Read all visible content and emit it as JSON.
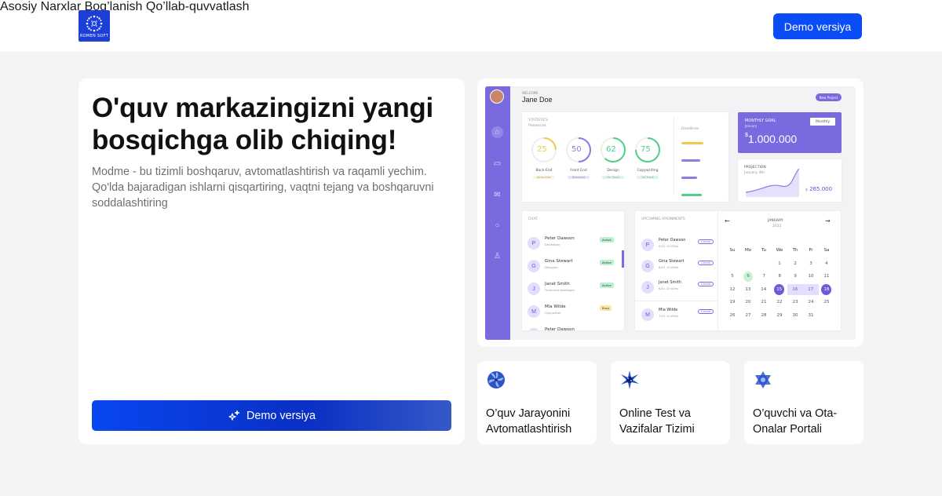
{
  "brand": {
    "logo_text": "ROMEN SOFT"
  },
  "nav": {
    "items": [
      "Asosiy",
      "Narxlar",
      "Bog’lanish",
      "Qo’llab-quvvatlash"
    ]
  },
  "header": {
    "cta_label": "Demo versiya"
  },
  "hero": {
    "title": "O'quv markazingizni yangi bosqichga olib chiqing!",
    "subtitle": "Modme - bu tizimli boshqaruv, avtomatlashtirish va raqamli yechim. Qo'lda bajaradigan ishlarni qisqartiring, vaqtni tejang va boshqaruvni soddalashtiring",
    "cta_label": "Demo versiya"
  },
  "dashboard": {
    "welcome": "WELCOME",
    "user_name": "Jane Doe",
    "new_project": "New Project",
    "statistics": {
      "title": "STATISTICS",
      "sub": "Presences",
      "rings": [
        {
          "value": "25",
          "label": "Back-End",
          "tag": "Junior Dev",
          "color": "#f2c94c"
        },
        {
          "value": "50",
          "label": "Front End",
          "tag": "Designed",
          "color": "#8a7ce6"
        },
        {
          "value": "62",
          "label": "Design",
          "tag": "On Track",
          "color": "#4fcf8a"
        },
        {
          "value": "75",
          "label": "Copywriting",
          "tag": "On Track",
          "color": "#4fcf8a"
        }
      ],
      "deadlines_title": "Deadlines"
    },
    "goal": {
      "label": "MONTHLY GOAL",
      "sub": "January",
      "period": "Monthly",
      "amount": "1.000.000",
      "currency": "$"
    },
    "projection": {
      "label": "PROJECTION",
      "sub": "January 4th",
      "amount": "265.000",
      "currency": "$"
    },
    "chat": {
      "title": "CHAT",
      "people": [
        {
          "initial": "P",
          "name": "Peter Dawson",
          "role": "Developer",
          "status": "Active",
          "status_color": "#bdf0cf"
        },
        {
          "initial": "G",
          "name": "Gina Stewart",
          "role": "Designer",
          "status": "Active",
          "status_color": "#bdf0cf"
        },
        {
          "initial": "J",
          "name": "Janet Smith",
          "role": "Front end developer",
          "status": "Active",
          "status_color": "#bdf0cf"
        },
        {
          "initial": "M",
          "name": "Mia Wilde",
          "role": "Copywriter",
          "status": "Busy",
          "status_color": "#fbe7a6"
        },
        {
          "initial": "P",
          "name": "Peter Dawson",
          "role": "",
          "status": "",
          "status_color": "#fff"
        }
      ]
    },
    "appointments": {
      "title": "UPCOMING APOINMENTS",
      "people": [
        {
          "initial": "P",
          "name": "Peter Dawson",
          "meta": "6/01  10:00hs",
          "action": "Cancel"
        },
        {
          "initial": "G",
          "name": "Gina Stewart",
          "meta": "6/01  10:00hs",
          "action": "Cancel"
        },
        {
          "initial": "J",
          "name": "Janet Smith",
          "meta": "6/01  10:00hs",
          "action": "Cancel"
        },
        {
          "initial": "M",
          "name": "Mia Wilde",
          "meta": "7/01  10:00hs",
          "action": "Cancel"
        }
      ]
    },
    "calendar": {
      "month": "JANUARY",
      "year": "2022",
      "weekdays": [
        "Su",
        "Mo",
        "Tu",
        "We",
        "Th",
        "Fr",
        "Sa"
      ],
      "weeks": [
        [
          "",
          "",
          "",
          "1",
          "2",
          "3",
          "4"
        ],
        [
          "5",
          "6",
          "7",
          "8",
          "9",
          "10",
          "11"
        ],
        [
          "12",
          "13",
          "14",
          "15",
          "16",
          "17",
          "18"
        ],
        [
          "19",
          "20",
          "21",
          "22",
          "23",
          "24",
          "25"
        ],
        [
          "26",
          "27",
          "28",
          "29",
          "30",
          "31",
          ""
        ]
      ]
    }
  },
  "features": [
    {
      "label": "O’quv Jarayonini Avtomatlashtirish",
      "icon": "pinwheel-icon"
    },
    {
      "label": "Online Test va Vazifalar Tizimi",
      "icon": "star-burst-icon"
    },
    {
      "label": "O’quvchi va Ota-Onalar Portali",
      "icon": "star-of-david-icon"
    }
  ],
  "colors": {
    "primary": "#0a4cf5",
    "dashboard_accent": "#7a6ae0",
    "background": "#f4f4f5"
  }
}
